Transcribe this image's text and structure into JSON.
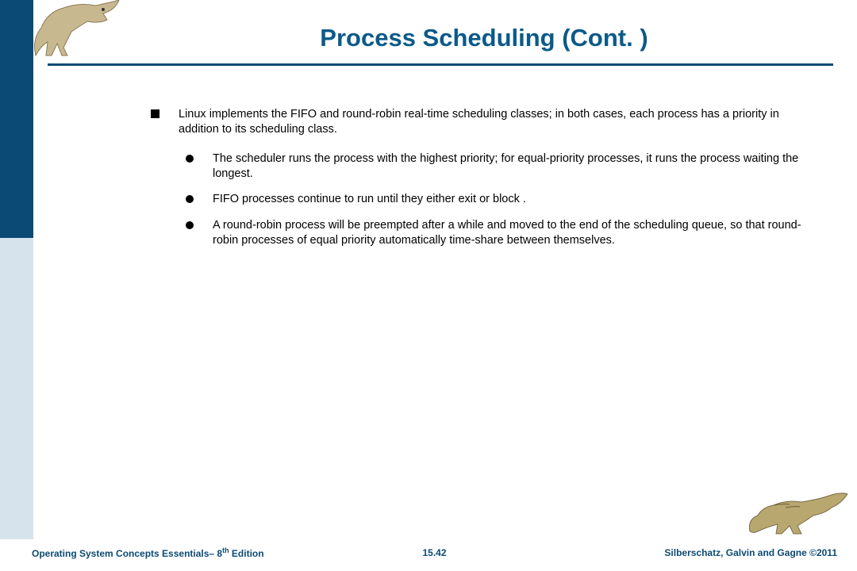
{
  "title": "Process Scheduling (Cont. )",
  "main_bullet": "Linux implements the FIFO and round-robin real-time scheduling classes; in both cases, each process has a priority in addition to its scheduling class.",
  "sub_bullets": [
    "The scheduler runs the process with the highest priority; for equal-priority processes, it runs the process waiting the longest.",
    "FIFO processes continue to run until they either exit or block .",
    "A round-robin process will be preempted after a while and moved to the end of the scheduling queue, so that round-robin processes of equal priority automatically time-share between themselves."
  ],
  "footer": {
    "left_prefix": "Operating System Concepts Essentials– 8",
    "left_suffix": " Edition",
    "left_sup": "th",
    "center": "15.42",
    "right_prefix": "Silberschatz, Galvin and Gagne ",
    "right_suffix": "2011",
    "copyright": "©"
  },
  "decorations": {
    "top_dino": "dinosaur-standing",
    "bottom_dino": "dinosaur-crouching"
  }
}
